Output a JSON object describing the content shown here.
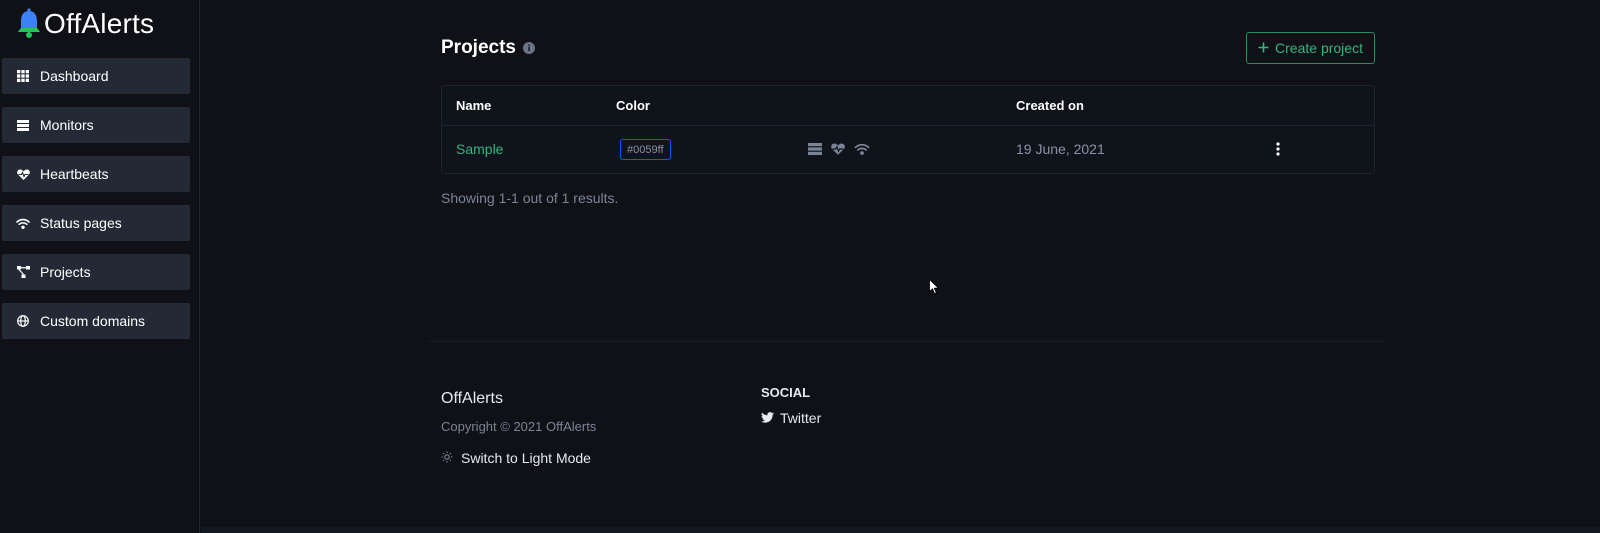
{
  "brand": {
    "name": "OffAlerts"
  },
  "sidebar": {
    "items": [
      {
        "label": "Dashboard",
        "icon": "grid-icon"
      },
      {
        "label": "Monitors",
        "icon": "list-icon"
      },
      {
        "label": "Heartbeats",
        "icon": "heart-pulse-icon"
      },
      {
        "label": "Status pages",
        "icon": "wifi-icon"
      },
      {
        "label": "Projects",
        "icon": "project-diagram-icon"
      },
      {
        "label": "Custom domains",
        "icon": "globe-icon"
      }
    ]
  },
  "page": {
    "title": "Projects",
    "create_label": "Create project"
  },
  "table": {
    "headers": {
      "name": "Name",
      "color": "Color",
      "created": "Created on"
    },
    "rows": [
      {
        "name": "Sample",
        "color": "#0059ff",
        "created": "19 June, 2021"
      }
    ]
  },
  "pagination": {
    "text": "Showing 1-1 out of 1 results."
  },
  "footer": {
    "brand": "OffAlerts",
    "copyright": "Copyright © 2021 OffAlerts",
    "theme_toggle": "Switch to Light Mode",
    "social_heading": "SOCIAL",
    "twitter": "Twitter"
  },
  "colors": {
    "background": "#0f1117",
    "nav_item": "#232a36",
    "accent_green": "#37b47f",
    "muted": "#7b8496"
  }
}
